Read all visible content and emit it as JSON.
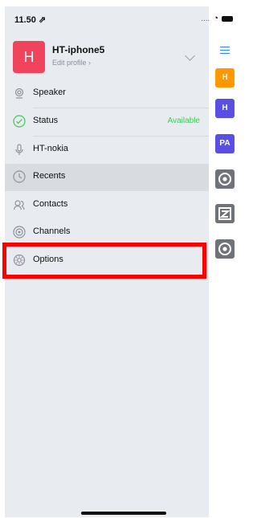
{
  "status_bar": {
    "time": "11.50 ⇗",
    "signal_text": "...."
  },
  "profile": {
    "avatar_letter": "H",
    "name": "HT-iphone5",
    "edit_label": "Edit profile ›"
  },
  "menu": {
    "items": [
      {
        "label": "Speaker",
        "icon": "speaker-icon"
      },
      {
        "label": "Status",
        "value": "Available",
        "icon": "status-check-icon"
      },
      {
        "label": "HT-nokia",
        "icon": "microphone-icon"
      },
      {
        "label": "Recents",
        "icon": "clock-icon",
        "active": true
      },
      {
        "label": "Contacts",
        "icon": "contacts-icon"
      },
      {
        "label": "Channels",
        "icon": "channels-icon"
      },
      {
        "label": "Options",
        "icon": "options-gear-icon"
      }
    ]
  },
  "side_panel": {
    "tiles": [
      {
        "label": "H",
        "color": "#ff9800"
      },
      {
        "label": "H",
        "color": "#5a4fe4"
      },
      {
        "label": "PA",
        "color": "#5a4fe4"
      },
      {
        "label": "",
        "color": "#6f7277",
        "icon": "channel-icon"
      },
      {
        "label": "",
        "color": "#6f7277",
        "icon": "z-channel-icon"
      },
      {
        "label": "",
        "color": "#6f7277",
        "icon": "channel-icon"
      }
    ]
  },
  "colors": {
    "accent_blue": "#2f86f6",
    "available_green": "#43c85a",
    "highlight_red": "#ff0000",
    "drawer_background": "#e8ebf0"
  }
}
